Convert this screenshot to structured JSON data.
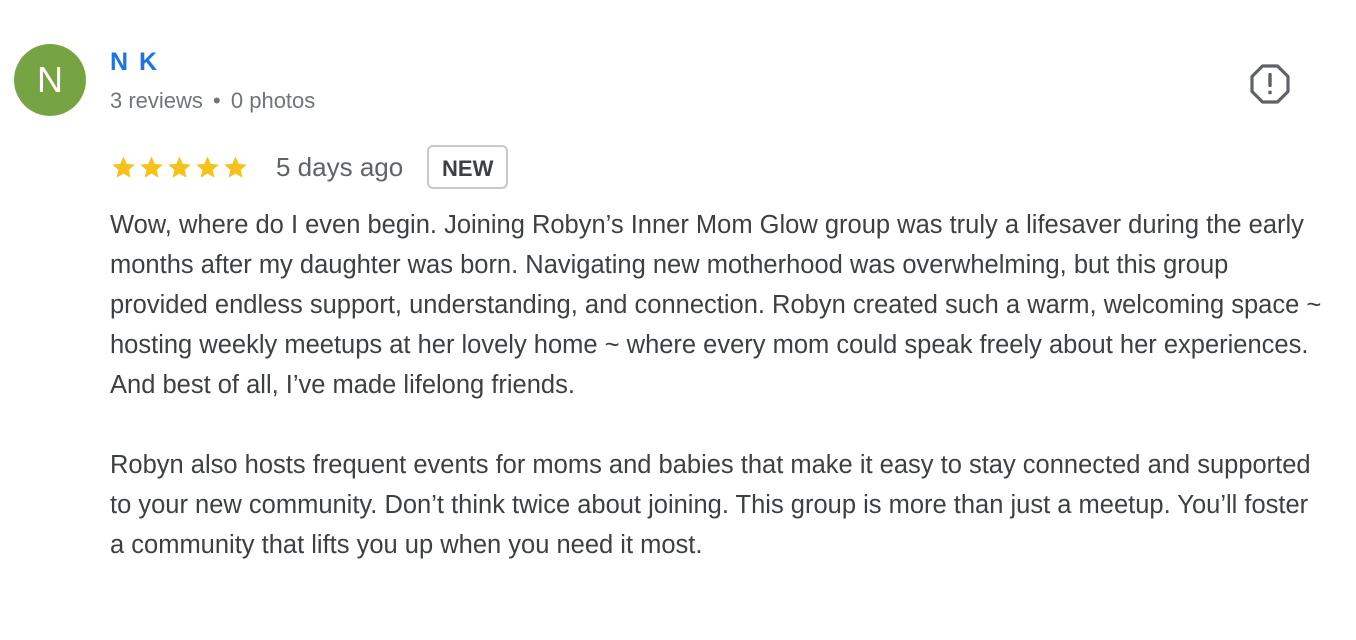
{
  "review": {
    "author": {
      "initial": "N",
      "name": "N K",
      "reviews": "3 reviews",
      "separator": "•",
      "photos": "0 photos",
      "avatar_color": "#76a443"
    },
    "flag_icon": "report-flag-icon",
    "rating": {
      "stars": 5,
      "max": 5,
      "star_color": "#f4c21b"
    },
    "date": "5 days ago",
    "badge": "NEW",
    "paragraphs": [
      "Wow, where do I even begin. Joining Robyn’s Inner Mom Glow group was truly a lifesaver during the early months after my daughter was born. Navigating new motherhood was overwhelming, but this group provided endless support, understanding, and connection. Robyn created such a warm, welcoming space ~ hosting weekly meetups at her lovely home ~ where every mom could speak freely about her experiences. And best of all, I’ve made lifelong friends.",
      "Robyn also hosts frequent events for moms and babies that make it easy to stay connected and supported to your new community. Don’t think twice about joining. This group is more than just a meetup. You’ll foster a community that lifts you up when you need it most."
    ]
  }
}
